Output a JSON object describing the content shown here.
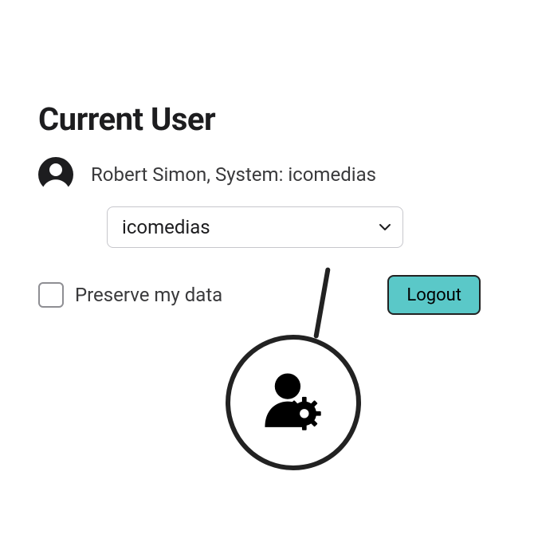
{
  "title": "Current User",
  "user": {
    "display": "Robert Simon, System: icomedias"
  },
  "system_select": {
    "value": "icomedias"
  },
  "preserve": {
    "label": "Preserve my data",
    "checked": false
  },
  "actions": {
    "logout_label": "Logout"
  },
  "callout": {
    "icon": "user-gear-icon"
  }
}
